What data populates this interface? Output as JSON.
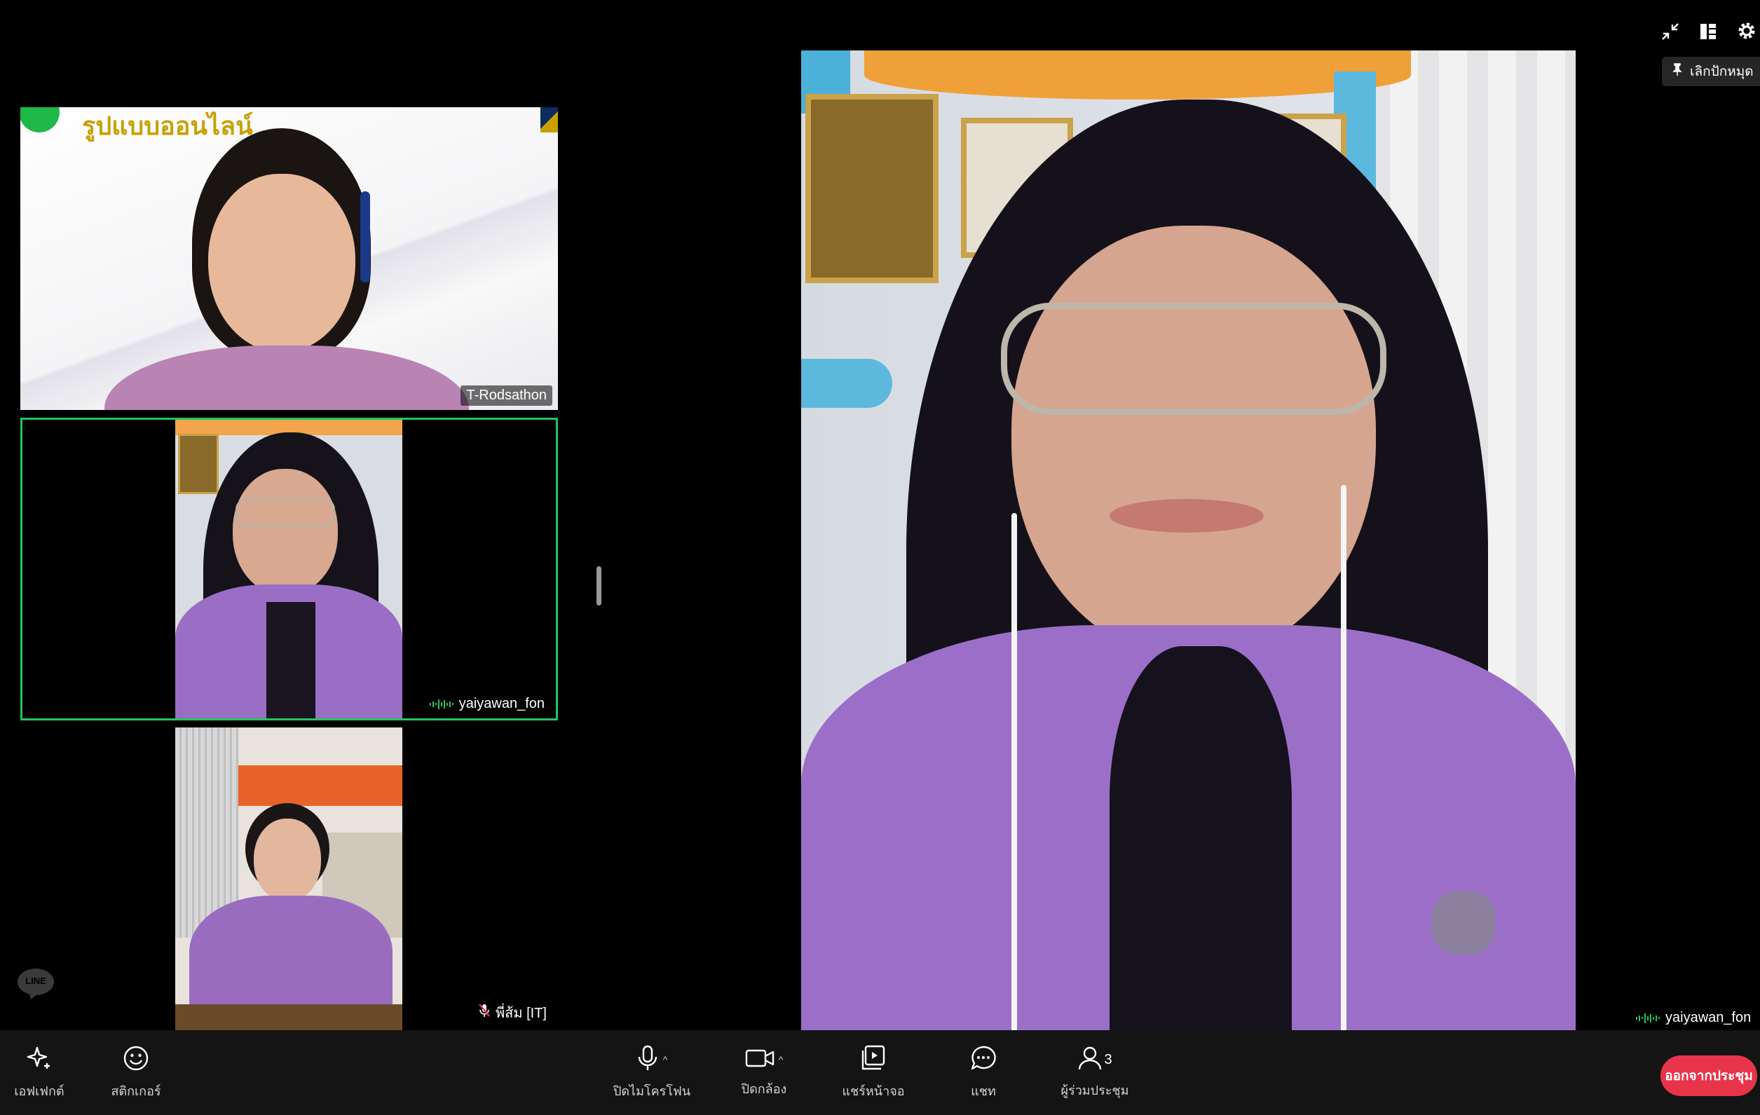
{
  "top_controls": {
    "minimize_icon": "collapse-arrows-icon",
    "layout_icon": "layout-icon",
    "settings_icon": "gear-icon",
    "unpin_label": "เลิกปักหมุด"
  },
  "tiles": [
    {
      "name": "T-Rodsathon",
      "banner_text": "รูปแบบออนไลน์",
      "speaking": false,
      "muted": false
    },
    {
      "name": "yaiyawan_fon",
      "speaking": true,
      "muted": false,
      "active": true
    },
    {
      "name": "พี่ส้ม [IT]",
      "speaking": false,
      "muted": true
    }
  ],
  "main_video": {
    "name": "yaiyawan_fon",
    "speaking": true
  },
  "watermark": "LINE",
  "toolbar": {
    "effects_label": "เอฟเฟกต์",
    "stickers_label": "สติกเกอร์",
    "mic_label": "ปิดไมโครโฟน",
    "camera_label": "ปิดกล้อง",
    "share_label": "แชร์หน้าจอ",
    "chat_label": "แชท",
    "participants_label": "ผู้ร่วมประชุม",
    "participants_count": "3",
    "leave_label": "ออกจากประชุม"
  },
  "colors": {
    "background": "#000000",
    "toolbar_bg": "#141414",
    "active_border": "#22c55e",
    "speaking_green": "#22c55e",
    "leave_red": "#e8344a",
    "banner_gold": "#c8a000"
  }
}
